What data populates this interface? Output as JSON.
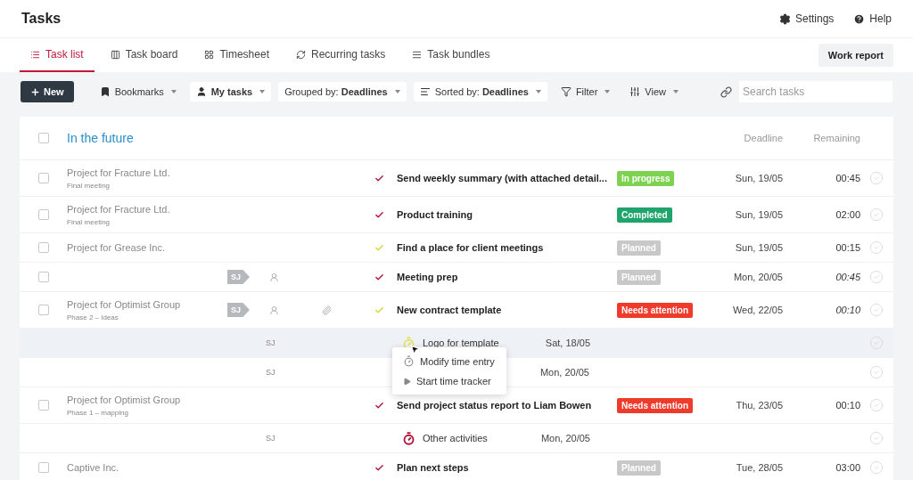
{
  "header": {
    "title": "Tasks",
    "links": [
      {
        "kind": "settings",
        "label": "Settings"
      },
      {
        "kind": "help",
        "label": "Help"
      }
    ]
  },
  "tabs": [
    {
      "kind": "list",
      "label": "Task list",
      "selected": true
    },
    {
      "kind": "board",
      "label": "Task board",
      "selected": false
    },
    {
      "kind": "sheet",
      "label": "Timesheet",
      "selected": false
    },
    {
      "kind": "recurring",
      "label": "Recurring tasks",
      "selected": false
    },
    {
      "kind": "bundles",
      "label": "Task bundles",
      "selected": false
    }
  ],
  "work_report": "Work report",
  "toolbar": {
    "new_button": "New",
    "items": [
      {
        "kind": "bookmark",
        "boxed": false,
        "label": "Bookmarks"
      },
      {
        "kind": "user",
        "boxed": true,
        "label": "**My tasks**"
      },
      {
        "kind": "none",
        "boxed": true,
        "label": "Grouped by: **Deadlines**"
      },
      {
        "kind": "sort",
        "boxed": true,
        "label": "Sorted by: **Deadlines**"
      },
      {
        "kind": "filter",
        "boxed": false,
        "label": "Filter"
      },
      {
        "kind": "view",
        "boxed": false,
        "label": "View"
      }
    ],
    "search": {
      "placeholder": "Search tasks"
    }
  },
  "group": {
    "title": "In the future",
    "checked": false,
    "columns": [
      "Deadline",
      "Remaining"
    ]
  },
  "rows": [
    {
      "kind": "task",
      "checked": false,
      "project": "Project for Fracture Ltd.",
      "phase": "Final meeting",
      "check": {
        "color": "#b0163a"
      },
      "title": "Send weekly summary (with attached detail...",
      "status": {
        "label": "In progress",
        "color": "#7dd34f"
      },
      "deadline": "Sun, 19/05",
      "remaining": "00:45",
      "estimated": false
    },
    {
      "kind": "task",
      "checked": false,
      "project": "Project for Fracture Ltd.",
      "phase": "Final meeting",
      "check": {
        "color": "#b0163a"
      },
      "title": "Product training",
      "status": {
        "label": "Completed",
        "color": "#1fa56c"
      },
      "deadline": "Sun, 19/05",
      "remaining": "02:00",
      "estimated": false
    },
    {
      "kind": "task",
      "checked": false,
      "project": "Project for Grease Inc.",
      "check": {
        "color": "#d6d83a"
      },
      "title": "Find a place for client meetings",
      "status": {
        "label": "Planned",
        "color": "#c8c8c8"
      },
      "deadline": "Sun, 19/05",
      "remaining": "00:15",
      "estimated": false
    },
    {
      "kind": "task",
      "checked": false,
      "assignee": "SJ",
      "check": {
        "color": "#b0163a"
      },
      "title": "Meeting prep",
      "status": {
        "label": "Planned",
        "color": "#c8c8c8"
      },
      "deadline": "Mon, 20/05",
      "remaining": "00:45",
      "estimated": true
    },
    {
      "kind": "task",
      "checked": false,
      "project": "Project for Optimist Group",
      "phase": "Phase 2 – Ideas",
      "assignee": "SJ",
      "attachment": true,
      "check": {
        "color": "#d6d83a"
      },
      "title": "New contract template",
      "status": {
        "label": "Needs attention",
        "color": "#ef3b2c"
      },
      "deadline": "Wed, 22/05",
      "remaining": "00:10",
      "estimated": true
    },
    {
      "kind": "entry",
      "assignee": "SJ",
      "icon": {
        "color": "#e3e36a"
      },
      "title": "Logo for template",
      "date": "Sat, 18/05",
      "hovered": true
    },
    {
      "kind": "entry",
      "assignee": "SJ",
      "date": "Mon, 20/05",
      "hovered": false
    },
    {
      "kind": "task",
      "checked": false,
      "project": "Project for Optimist Group",
      "phase": "Phase 1 – mapping",
      "check": {
        "color": "#b0163a"
      },
      "title": "Send project status report to Liam Bowen",
      "status": {
        "label": "Needs attention",
        "color": "#ef3b2c"
      },
      "deadline": "Thu, 23/05",
      "remaining": "00:10",
      "estimated": false
    },
    {
      "kind": "entry",
      "assignee": "SJ",
      "icon": {
        "color": "#b0163a"
      },
      "title": "Other activities",
      "date": "Mon, 20/05",
      "hovered": false
    },
    {
      "kind": "task",
      "checked": false,
      "project": "Captive Inc.",
      "check": {
        "color": "#b0163a"
      },
      "title": "Plan next steps",
      "status": {
        "label": "Planned",
        "color": "#c8c8c8"
      },
      "deadline": "Tue, 28/05",
      "remaining": "03:00",
      "estimated": false
    }
  ],
  "context_menu": [
    {
      "kind": "timer",
      "label": "Modify time entry"
    },
    {
      "kind": "play",
      "label": "Start time tracker"
    }
  ]
}
